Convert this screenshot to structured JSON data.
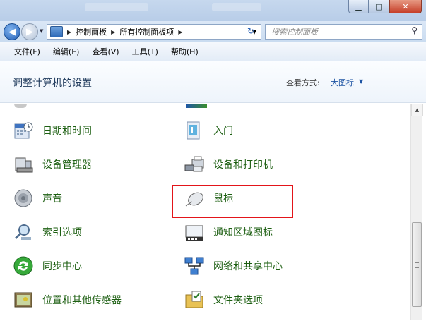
{
  "window": {
    "buttons": {
      "minimize": "▁",
      "maximize": "□",
      "close": "✕"
    }
  },
  "nav": {
    "back": "◀",
    "forward": "▶",
    "breadcrumb": [
      "控制面板",
      "所有控制面板项"
    ],
    "search_placeholder": "搜索控制面板"
  },
  "menu": {
    "items": [
      "文件(F)",
      "编辑(E)",
      "查看(V)",
      "工具(T)",
      "帮助(H)"
    ]
  },
  "header": {
    "title": "调整计算机的设置",
    "view_by_label": "查看方式:",
    "view_by_value": "大图标"
  },
  "items": [
    {
      "label": "日期和时间",
      "icon": "calendar-clock-icon"
    },
    {
      "label": "入门",
      "icon": "getting-started-icon"
    },
    {
      "label": "设备管理器",
      "icon": "device-manager-icon"
    },
    {
      "label": "设备和打印机",
      "icon": "printer-icon"
    },
    {
      "label": "声音",
      "icon": "speaker-icon"
    },
    {
      "label": "鼠标",
      "icon": "mouse-icon"
    },
    {
      "label": "索引选项",
      "icon": "index-search-icon"
    },
    {
      "label": "通知区域图标",
      "icon": "notification-area-icon"
    },
    {
      "label": "同步中心",
      "icon": "sync-center-icon"
    },
    {
      "label": "网络和共享中心",
      "icon": "network-icon"
    },
    {
      "label": "位置和其他传感器",
      "icon": "location-sensor-icon"
    },
    {
      "label": "文件夹选项",
      "icon": "folder-options-icon"
    }
  ],
  "highlight": {
    "color": "#e3151a"
  },
  "colors": {
    "item_text": "#1d5f12",
    "title": "#1e395b",
    "link": "#1e54a3"
  }
}
